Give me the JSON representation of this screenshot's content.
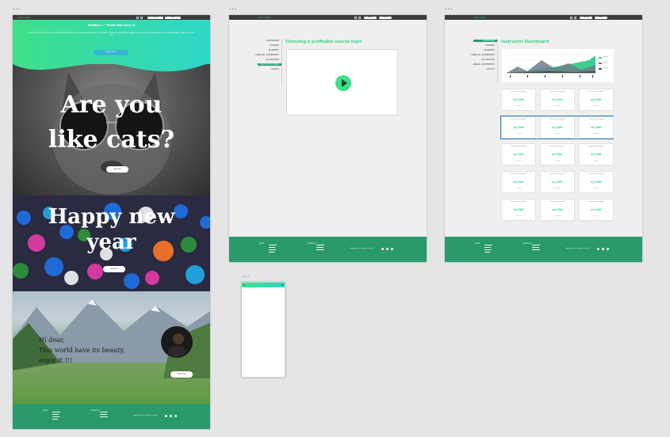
{
  "frames": [
    {
      "label": "•••"
    },
    {
      "label": "•••"
    },
    {
      "label": "•••"
    },
    {
      "label": "•••"
    }
  ],
  "topbar": {
    "logo": "⌂ themeweb",
    "btn1": "sign up",
    "btn2": "log in"
  },
  "landing": {
    "hero_title": "Headline 1 • Thank Hello Dear :D",
    "hero_text": "Lorem ipsum dolor sit amet consectetur adipiscing elit sed do eiusmod tempor incididunt ut labore et dolore magna aliqua ut enim ad minim veniam quis nostrud exercitation ullamco laboris nisi",
    "hero_button": "LEARN MORE",
    "cats_line1": "Are you",
    "cats_line2": "like cats?",
    "cats_button": "MORE INFO",
    "ny_line1": "Happy new",
    "ny_line2": "year",
    "ny_button": "MORE INFO",
    "mountain_line1": "Hi dear,",
    "mountain_line2": "This world have its beauty,",
    "mountain_line3": "enjoy it.!!!",
    "mountain_button": "READ MORE"
  },
  "course": {
    "title": "Choosing a profitable course topic",
    "menu": [
      "DASHBOARD",
      "COURSES",
      "STUDENTS",
      "FINANCIAL STATEMENTS",
      "Q/A SECTION",
      "PROFILE SETTINGS",
      "LOGOUT"
    ],
    "active_index": 5
  },
  "dashboard": {
    "title": "Instructor Dashboard",
    "menu": [
      "DASHBOARD",
      "COURSES",
      "STUDENTS",
      "FINANCIAL STATEMENTS",
      "Q/A SECTION",
      "ANNUAL STATEMENTS",
      "LOGOUT"
    ],
    "active_index": 0,
    "legend": [
      "series 1",
      "series 2",
      "series 3"
    ],
    "colors": {
      "s1": "#3ecf8e",
      "s2": "#6d7d8b",
      "s3": "#3b4b5b"
    },
    "card_title": "Total number of students",
    "card_value": "$1,500",
    "card_sub": "see more"
  },
  "footer": {
    "col1_title": "about",
    "col2_title": "contact us",
    "copyright": "copyright 2018 all rights reserved"
  },
  "colors": {
    "accent": "#3ecf8e",
    "footer": "#2a9a6c",
    "topbar": "#3c3c3c",
    "selection": "#2f78c9"
  }
}
